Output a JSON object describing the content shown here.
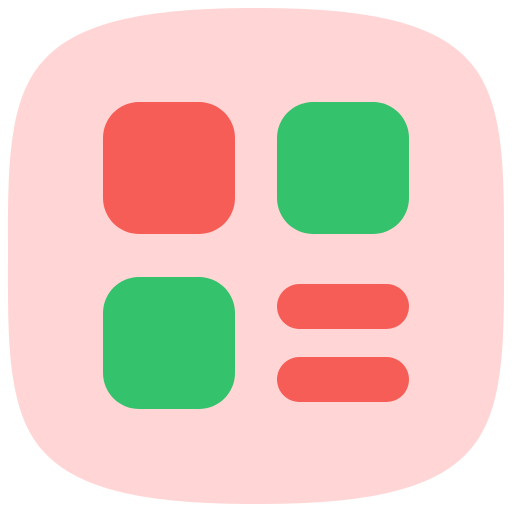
{
  "icon": {
    "name": "dashboard-categories-icon",
    "colors": {
      "background": "#FFD6D5",
      "red": "#F65D57",
      "green": "#34C26D"
    }
  }
}
